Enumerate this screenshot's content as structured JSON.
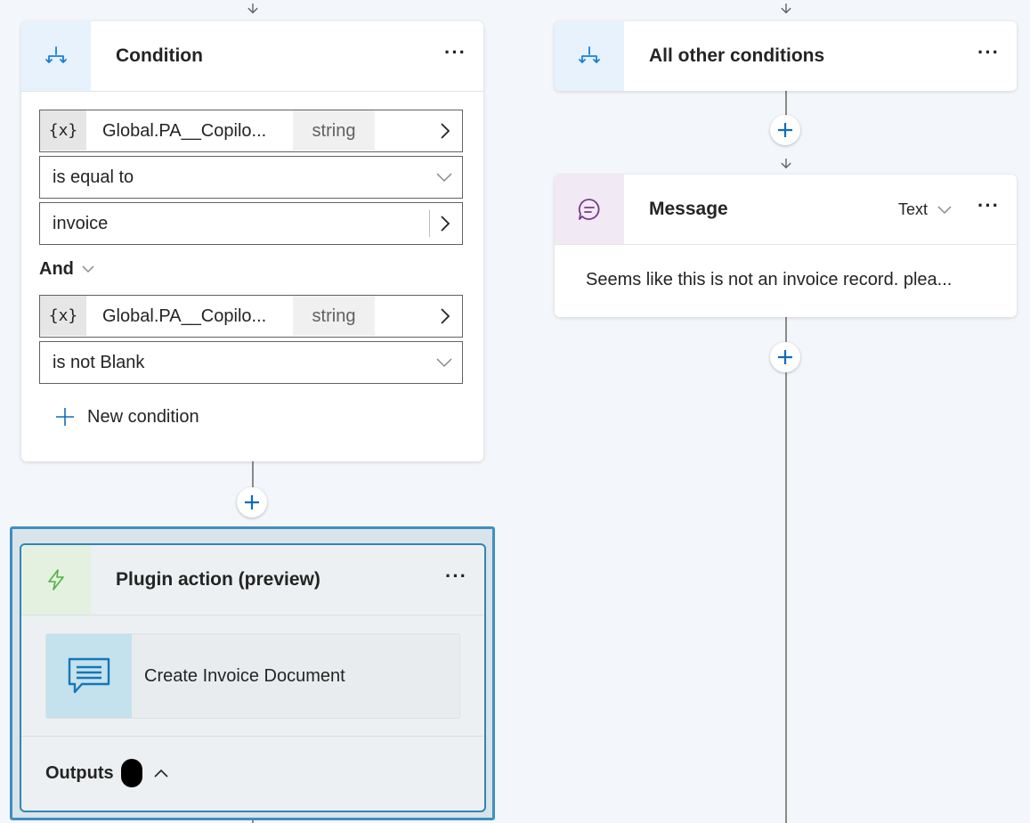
{
  "condition_card": {
    "title": "Condition",
    "more_label": "···",
    "rows": [
      {
        "variable_chip": "{x}",
        "variable_name": "Global.PA__Copilo...",
        "type": "string"
      },
      {
        "operator": "is equal to"
      },
      {
        "value": "invoice"
      }
    ],
    "join_label": "And",
    "rows2": [
      {
        "variable_chip": "{x}",
        "variable_name": "Global.PA__Copilo...",
        "type": "string"
      },
      {
        "operator": "is not Blank"
      }
    ],
    "new_condition_label": "New condition"
  },
  "other_card": {
    "title": "All other conditions",
    "more_label": "···"
  },
  "message_card": {
    "title": "Message",
    "format_label": "Text",
    "more_label": "···",
    "body": "Seems like this is not an invoice record. plea..."
  },
  "plugin_card": {
    "title": "Plugin action (preview)",
    "more_label": "···",
    "action_name": "Create Invoice Document",
    "outputs_label": "Outputs"
  },
  "colors": {
    "canvas": "#f3f6fa",
    "accent_blue": "#1a7fd6",
    "selection_border": "#2f86b5",
    "plus_teal": "#0f6cbd",
    "plugin_icon_green": "#52b043",
    "message_icon_purple": "#7a3a8c"
  },
  "icons": {
    "condition": "branch-icon",
    "message": "chat-bubble-icon",
    "plugin": "lightning-icon",
    "action": "message-lines-icon"
  }
}
